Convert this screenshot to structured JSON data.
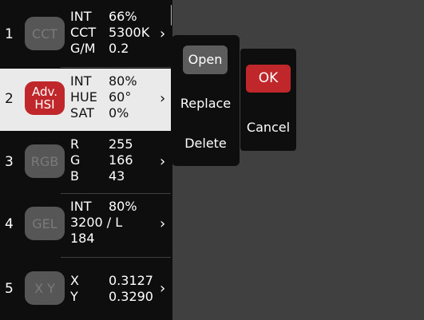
{
  "presets": [
    {
      "number": "1",
      "badge": "CCT",
      "lines": [
        {
          "key": "INT",
          "value": "66%"
        },
        {
          "key": "CCT",
          "value": "5300K"
        },
        {
          "key": "G/M",
          "value": "0.2"
        }
      ]
    },
    {
      "number": "2",
      "badge_line1": "Adv.",
      "badge_line2": "HSI",
      "lines": [
        {
          "key": "INT",
          "value": "80%"
        },
        {
          "key": "HUE",
          "value": "60°"
        },
        {
          "key": "SAT",
          "value": "0%"
        }
      ]
    },
    {
      "number": "3",
      "badge": "RGB",
      "lines": [
        {
          "key": "R",
          "value": "255"
        },
        {
          "key": "G",
          "value": "166"
        },
        {
          "key": "B",
          "value": "43"
        }
      ]
    },
    {
      "number": "4",
      "badge": "GEL",
      "int_key": "INT",
      "int_value": "80%",
      "gel_line": "3200 / L",
      "gel_number": "184"
    },
    {
      "number": "5",
      "badge": "X Y",
      "lines": [
        {
          "key": "X",
          "value": "0.3127"
        },
        {
          "key": "Y",
          "value": "0.3290"
        }
      ]
    }
  ],
  "chevron": "›",
  "menu": {
    "open": "Open",
    "replace": "Replace",
    "delete": "Delete"
  },
  "confirm": {
    "ok": "OK",
    "cancel": "Cancel"
  },
  "colors": {
    "accent_red": "#c0272b",
    "panel": "#0e0e0e",
    "background": "#404040",
    "selected_row": "#eaeaea"
  }
}
